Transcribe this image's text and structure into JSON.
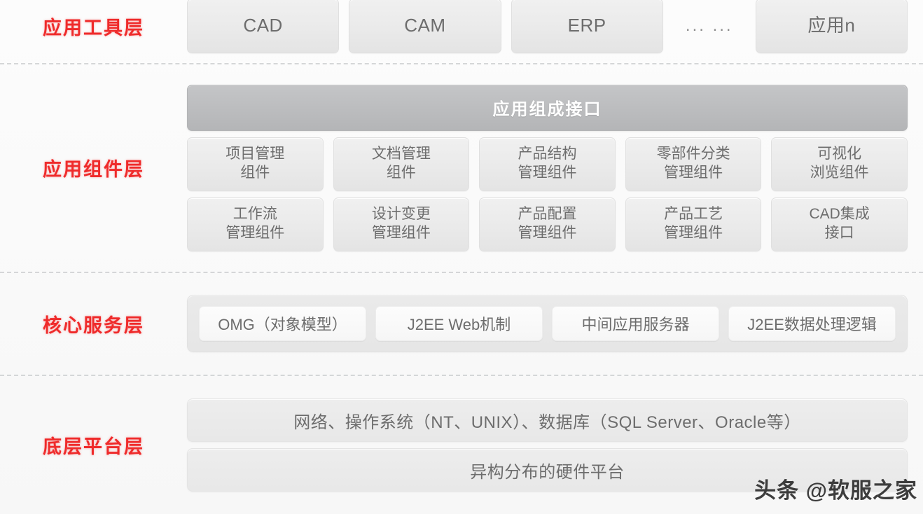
{
  "layers": [
    {
      "id": "application-tools",
      "label": "应用工具层",
      "label_color": "#ef2b2b",
      "items": [
        {
          "text": "CAD"
        },
        {
          "text": "CAM"
        },
        {
          "text": "ERP"
        },
        {
          "text": "... ..."
        },
        {
          "text": "应用n"
        }
      ]
    },
    {
      "id": "application-components",
      "label": "应用组件层",
      "label_color": "#ef2b2b",
      "interface_bar": "应用组成接口",
      "row1": [
        {
          "line1": "项目管理",
          "line2": "组件"
        },
        {
          "line1": "文档管理",
          "line2": "组件"
        },
        {
          "line1": "产品结构",
          "line2": "管理组件"
        },
        {
          "line1": "零部件分类",
          "line2": "管理组件"
        },
        {
          "line1": "可视化",
          "line2": "浏览组件"
        }
      ],
      "row2": [
        {
          "line1": "工作流",
          "line2": "管理组件"
        },
        {
          "line1": "设计变更",
          "line2": "管理组件"
        },
        {
          "line1": "产品配置",
          "line2": "管理组件"
        },
        {
          "line1": "产品工艺",
          "line2": "管理组件"
        },
        {
          "line1": "CAD集成",
          "line2": "接口"
        }
      ]
    },
    {
      "id": "core-services",
      "label": "核心服务层",
      "label_color": "#ef2b2b",
      "items": [
        {
          "text": "OMG（对象模型）"
        },
        {
          "text": "J2EE Web机制"
        },
        {
          "text": "中间应用服务器"
        },
        {
          "text": "J2EE数据处理逻辑"
        }
      ]
    },
    {
      "id": "base-platform",
      "label": "底层平台层",
      "label_color": "#ef2b2b",
      "items": [
        {
          "text": "网络、操作系统（NT、UNIX）、数据库（SQL Server、Oracle等）"
        },
        {
          "text": "异构分布的硬件平台"
        }
      ]
    }
  ],
  "watermark": "头条 @软服之家",
  "colors": {
    "label_red": "#ef2b2b",
    "box_fill": "#eaeaea",
    "box_text": "#6d6d6d",
    "interface_bar_fill": "#bcbdbf",
    "interface_bar_text": "#ffffff",
    "background": "#fbfbfb",
    "divider": "#c9cbcd"
  }
}
